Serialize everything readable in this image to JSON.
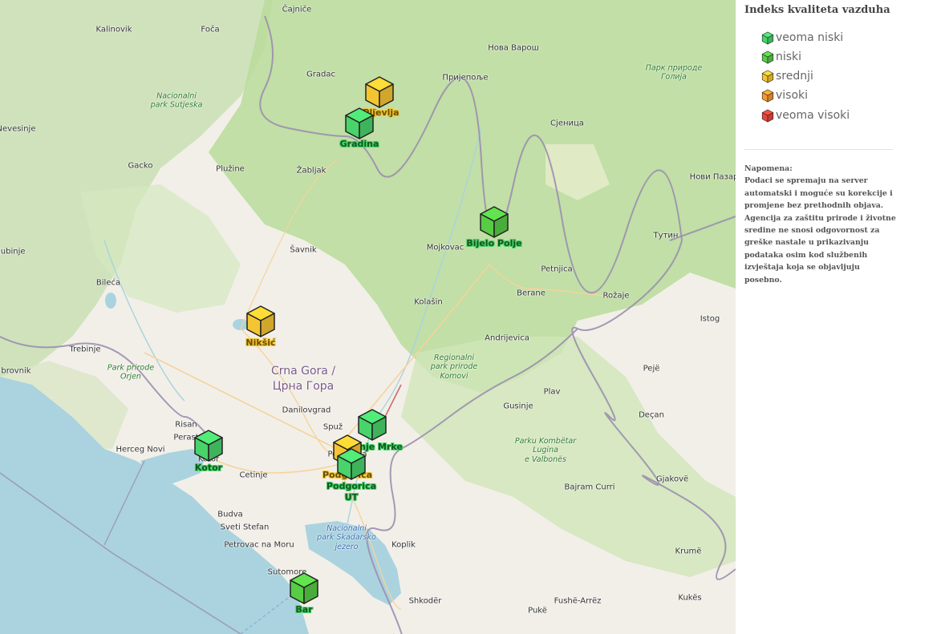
{
  "map": {
    "places": [
      {
        "id": "cajnice",
        "text": "Čajniče",
        "kind": "town"
      },
      {
        "id": "kalinovik",
        "text": "Kalinovik",
        "kind": "town"
      },
      {
        "id": "foca",
        "text": "Foča",
        "kind": "town"
      },
      {
        "id": "nova-varos",
        "text": "Нова Варош",
        "kind": "town"
      },
      {
        "id": "park-golija",
        "text": "Парк природе\nГолија",
        "kind": "park"
      },
      {
        "id": "gradac",
        "text": "Gradac",
        "kind": "town"
      },
      {
        "id": "prijepolje",
        "text": "Пријепоље",
        "kind": "town"
      },
      {
        "id": "park-sutjeska",
        "text": "Nacionalni\npark Sutjeska",
        "kind": "park"
      },
      {
        "id": "sjenica",
        "text": "Сјеница",
        "kind": "town"
      },
      {
        "id": "nevesinje",
        "text": "Nevesinje",
        "kind": "town"
      },
      {
        "id": "gacko",
        "text": "Gacko",
        "kind": "town"
      },
      {
        "id": "pluzine",
        "text": "Plužine",
        "kind": "town"
      },
      {
        "id": "zabljak",
        "text": "Žabljak",
        "kind": "town"
      },
      {
        "id": "novi-pazar",
        "text": "Нови Пазар",
        "kind": "town"
      },
      {
        "id": "tutin",
        "text": "Тутин",
        "kind": "town"
      },
      {
        "id": "ljubinje",
        "text": "Ljubinje",
        "kind": "town"
      },
      {
        "id": "savnik",
        "text": "Šavnik",
        "kind": "town"
      },
      {
        "id": "mojkovac",
        "text": "Mojkovac",
        "kind": "town"
      },
      {
        "id": "petnjica",
        "text": "Petnjica",
        "kind": "town"
      },
      {
        "id": "bileca",
        "text": "Bileća",
        "kind": "town"
      },
      {
        "id": "berane",
        "text": "Berane",
        "kind": "town"
      },
      {
        "id": "rozaje",
        "text": "Rožaje",
        "kind": "town"
      },
      {
        "id": "kolasin",
        "text": "Kolašin",
        "kind": "town"
      },
      {
        "id": "istog",
        "text": "Istog",
        "kind": "town"
      },
      {
        "id": "andrijevica",
        "text": "Andrijevica",
        "kind": "town"
      },
      {
        "id": "trebinje",
        "text": "Trebinje",
        "kind": "town"
      },
      {
        "id": "dubrovnik",
        "text": "brovnik",
        "kind": "town"
      },
      {
        "id": "park-komovi",
        "text": "Regionalni\npark prirode\nKomovi",
        "kind": "park"
      },
      {
        "id": "park-orjen",
        "text": "Park prirode\nOrjen",
        "kind": "park"
      },
      {
        "id": "crna-gora",
        "text": "Crna Gora /\nЦрна Гора",
        "kind": "country"
      },
      {
        "id": "pec",
        "text": "Pejë",
        "kind": "town"
      },
      {
        "id": "plav",
        "text": "Plav",
        "kind": "town"
      },
      {
        "id": "danilovgrad",
        "text": "Danilovgrad",
        "kind": "town"
      },
      {
        "id": "gusinje",
        "text": "Gusinje",
        "kind": "town"
      },
      {
        "id": "decan",
        "text": "Deçan",
        "kind": "town"
      },
      {
        "id": "risan",
        "text": "Risan",
        "kind": "town"
      },
      {
        "id": "spuz",
        "text": "Spuž",
        "kind": "town"
      },
      {
        "id": "perast",
        "text": "Perast",
        "kind": "town"
      },
      {
        "id": "park-valbones",
        "text": "Parku Kombëtar\nLugina\ne Valbonës",
        "kind": "park"
      },
      {
        "id": "herceg-novi",
        "text": "Herceg Novi",
        "kind": "town"
      },
      {
        "id": "cetinje",
        "text": "Cetinje",
        "kind": "town"
      },
      {
        "id": "gjakove",
        "text": "Gjakovë",
        "kind": "town"
      },
      {
        "id": "bajram-curri",
        "text": "Bajram Curri",
        "kind": "town"
      },
      {
        "id": "budva",
        "text": "Budva",
        "kind": "town"
      },
      {
        "id": "sveti-stefan",
        "text": "Sveti Stefan",
        "kind": "town"
      },
      {
        "id": "park-skadar",
        "text": "Nacionalni\npark Skadarsko\njezero",
        "kind": "water"
      },
      {
        "id": "petrovac",
        "text": "Petrovac na\nMoru",
        "kind": "town"
      },
      {
        "id": "koplik",
        "text": "Koplik",
        "kind": "town"
      },
      {
        "id": "kruma",
        "text": "Krumë",
        "kind": "town"
      },
      {
        "id": "sutomore",
        "text": "Sutomore",
        "kind": "town"
      },
      {
        "id": "kukes",
        "text": "Kukës",
        "kind": "town"
      },
      {
        "id": "shkoder",
        "text": "Shkodër",
        "kind": "town"
      },
      {
        "id": "fushe-arrez",
        "text": "Fushë-Arrëz",
        "kind": "town"
      },
      {
        "id": "puke",
        "text": "Pukë",
        "kind": "town"
      },
      {
        "id": "pljevlja-bg",
        "text": "Pljevlja",
        "kind": "town"
      },
      {
        "id": "podgorica-bg",
        "text": "Podgorica",
        "kind": "town"
      },
      {
        "id": "kotor-bg",
        "text": "Kotor",
        "kind": "town"
      }
    ],
    "stations": [
      {
        "id": "pljevlja",
        "label": "Pljevlja",
        "level": "srednji"
      },
      {
        "id": "gradina",
        "label": "Gradina",
        "level": "veoma niski"
      },
      {
        "id": "bijelo-polje",
        "label": "Bijelo Polje",
        "level": "niski"
      },
      {
        "id": "niksic",
        "label": "Nikšić",
        "level": "srednji"
      },
      {
        "id": "gornje-mrke",
        "label": "Gornje Mrke",
        "level": "veoma niski"
      },
      {
        "id": "kotor",
        "label": "Kotor",
        "level": "veoma niski"
      },
      {
        "id": "podgorica",
        "label": "Podgorica",
        "level": "srednji"
      },
      {
        "id": "podgorica-ut",
        "label": "Podgorica\nUT",
        "level": "veoma niski"
      },
      {
        "id": "bar",
        "label": "Bar",
        "level": "niski"
      }
    ]
  },
  "legend": {
    "title": "Indeks kvaliteta vazduha",
    "items": [
      {
        "label": "veoma niski",
        "color": "#49d36b"
      },
      {
        "label": "niski",
        "color": "#57cc45"
      },
      {
        "label": "srednji",
        "color": "#f5c531"
      },
      {
        "label": "visoki",
        "color": "#f39a2e"
      },
      {
        "label": "veoma visoki",
        "color": "#e8453c"
      }
    ]
  },
  "note": {
    "heading": "Napomena:",
    "text": "Podaci se spremaju na server automatski i moguće su korekcije i promjene bez prethodnih objava. Agencija za zaštitu prirode i životne sredine ne snosi odgovornost za greške nastale u prikazivanju podataka osim kod službenih izvještaja koja se objavljuju posebno."
  },
  "colors": {
    "veoma niski": "#49d36b",
    "niski": "#57cc45",
    "srednji": "#f5c531",
    "visoki": "#f39a2e",
    "veoma visoki": "#e8453c"
  }
}
